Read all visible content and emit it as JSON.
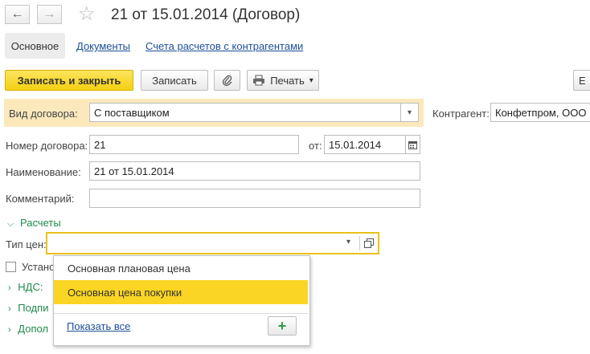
{
  "header": {
    "back_icon": "←",
    "forward_icon": "→",
    "star_icon": "☆",
    "title": "21 от 15.01.2014 (Договор)"
  },
  "tabs": [
    {
      "label": "Основное"
    },
    {
      "label": "Документы"
    },
    {
      "label": "Счета расчетов с контрагентами"
    }
  ],
  "toolbar": {
    "save_close_label": "Записать и закрыть",
    "save_label": "Записать",
    "attach_icon": "paperclip-icon",
    "print_label": "Печать",
    "print_arrow": "▾",
    "more_label": "Е"
  },
  "form": {
    "contract_type_label": "Вид договора:",
    "contract_type_value": "С поставщиком",
    "counterparty_label": "Контрагент:",
    "counterparty_value": "Конфетпром, ООО",
    "number_label": "Номер договора:",
    "number_value": "21",
    "from_label": "от:",
    "date_value": "15.01.2014",
    "name_label": "Наименование:",
    "name_value": "21 от 15.01.2014",
    "comment_label": "Комментарий:",
    "comment_value": ""
  },
  "sections": {
    "settlements": "Расчеты",
    "price_type_label": "Тип цен:",
    "price_type_value": "",
    "checkbox_label_partial": "Устано",
    "vat_partial": "НДС:",
    "signature_partial": "Подпи",
    "additional_partial": "Допол"
  },
  "dropdown": {
    "items": [
      {
        "label": "Основная плановая цена"
      },
      {
        "label": "Основная цена покупки"
      }
    ],
    "show_all": "Показать все",
    "add_symbol": "+"
  },
  "colors": {
    "primary_button": "#f4cf11",
    "highlight_row": "#fbe9bc",
    "selected_item": "#fbd523",
    "section_green": "#1f8a4c",
    "link_blue": "#1a4f99",
    "focus_border": "#e8c21b"
  }
}
